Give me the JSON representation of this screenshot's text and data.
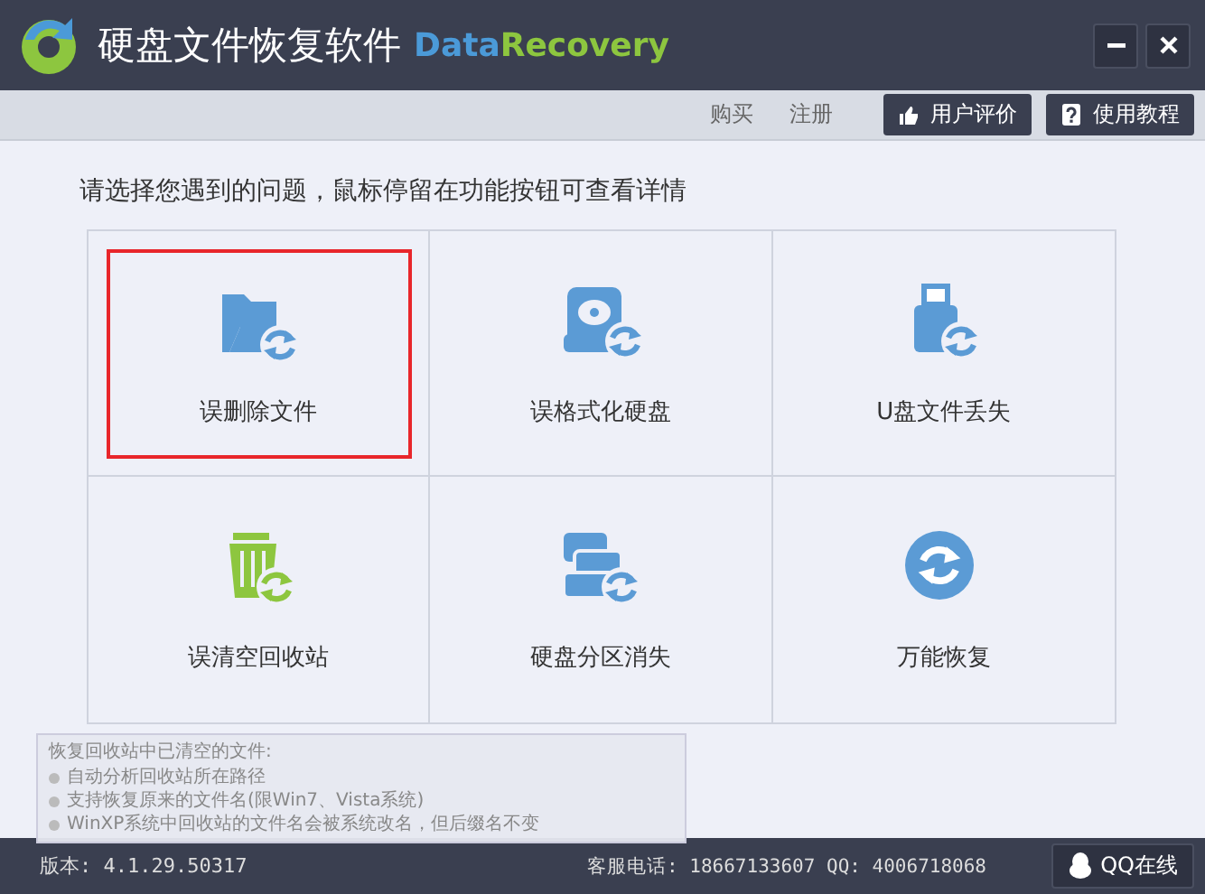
{
  "window": {
    "title": "硬盘文件恢复软件",
    "brand_part_1": "Data",
    "brand_part_2": "Recovery"
  },
  "toolbar": {
    "links": [
      "购买",
      "注册"
    ],
    "buttons": [
      {
        "label": "用户评价",
        "kind": "thumb"
      },
      {
        "label": "使用教程",
        "kind": "help"
      }
    ]
  },
  "prompt": "请选择您遇到的问题，鼠标停留在功能按钮可查看详情",
  "options": [
    {
      "label": "误删除文件",
      "kind": "folder",
      "selected": true
    },
    {
      "label": "误格式化硬盘",
      "kind": "disk",
      "selected": false
    },
    {
      "label": "U盘文件丢失",
      "kind": "usb",
      "selected": false
    },
    {
      "label": "误清空回收站",
      "kind": "trash",
      "selected": false
    },
    {
      "label": "硬盘分区消失",
      "kind": "disks",
      "selected": false
    },
    {
      "label": "万能恢复",
      "kind": "refresh",
      "selected": false
    }
  ],
  "tooltip": {
    "title": "恢复回收站中已清空的文件:",
    "items": [
      "自动分析回收站所在路径",
      "支持恢复原来的文件名(限Win7、Vista系统)",
      "WinXP系统中回收站的文件名会被系统改名，但后缀名不变"
    ]
  },
  "status_bar": {
    "version": "版本: 4.1.29.50317",
    "contact": "客服电话: 18667133607 QQ: 4006718068",
    "qq_button": "QQ在线"
  }
}
